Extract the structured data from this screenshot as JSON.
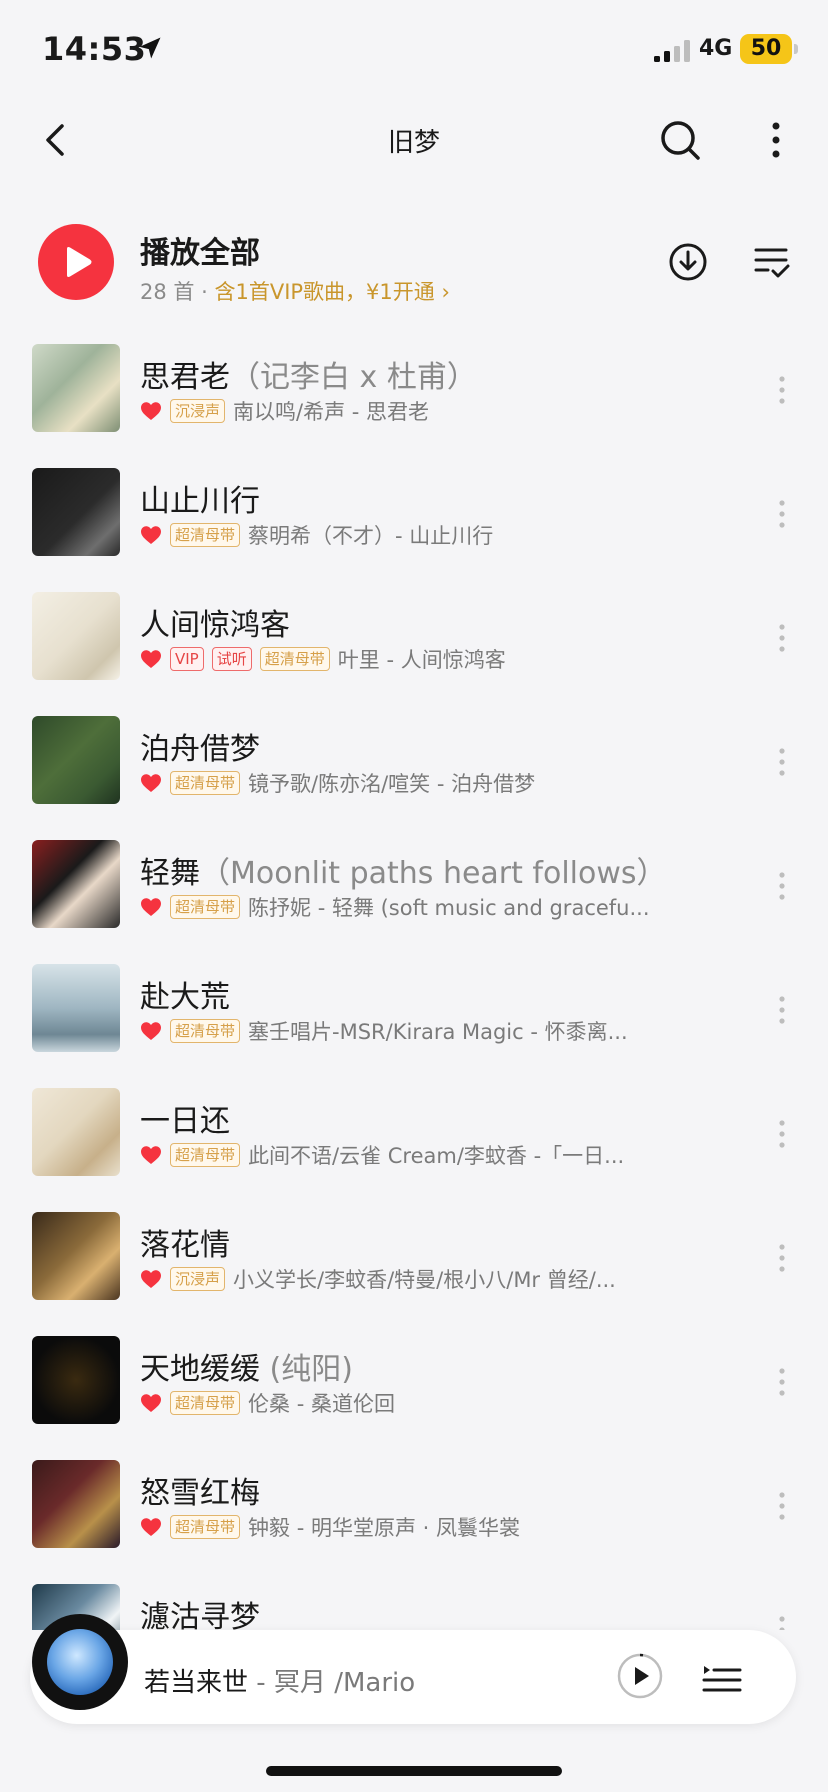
{
  "status_bar": {
    "time": "14:53",
    "network": "4G",
    "battery": "50"
  },
  "header": {
    "title": "旧梦"
  },
  "play_all": {
    "title": "播放全部",
    "count": "28 首",
    "separator": "·",
    "vip_text": "含1首VIP歌曲，¥1开通",
    "vip_chevron": "›"
  },
  "songs": [
    {
      "title": "思君老",
      "suffix": "（记李白 x 杜甫）",
      "tags": [
        "沉浸声"
      ],
      "artist": "南以鸣/希声 - 思君老",
      "cover": "cover-1"
    },
    {
      "title": "山止川行",
      "suffix": "",
      "tags": [
        "超清母带"
      ],
      "artist": "蔡明希（不才）- 山止川行",
      "cover": "cover-2"
    },
    {
      "title": "人间惊鸿客",
      "suffix": "",
      "tags": [
        "VIP",
        "试听",
        "超清母带"
      ],
      "artist": "叶里 - 人间惊鸿客",
      "cover": "cover-3"
    },
    {
      "title": "泊舟借梦",
      "suffix": "",
      "tags": [
        "超清母带"
      ],
      "artist": "镜予歌/陈亦洺/喧笑 - 泊舟借梦",
      "cover": "cover-4"
    },
    {
      "title": "轻舞",
      "suffix": "（Moonlit paths heart follows）",
      "tags": [
        "超清母带"
      ],
      "artist": "陈抒妮 - 轻舞 (soft music and gracefu...",
      "cover": "cover-5"
    },
    {
      "title": "赴大荒",
      "suffix": "",
      "tags": [
        "超清母带"
      ],
      "artist": "塞壬唱片-MSR/Kirara Magic - 怀黍离...",
      "cover": "cover-6"
    },
    {
      "title": "一日还",
      "suffix": "",
      "tags": [
        "超清母带"
      ],
      "artist": "此间不语/云雀 Cream/李蚊香 -「一日...",
      "cover": "cover-7"
    },
    {
      "title": "落花情",
      "suffix": "",
      "tags": [
        "沉浸声"
      ],
      "artist": "小义学长/李蚊香/特曼/根小八/Mr 曾经/...",
      "cover": "cover-8"
    },
    {
      "title": "天地缓缓",
      "suffix": " (纯阳)",
      "tags": [
        "超清母带"
      ],
      "artist": "伦桑 - 桑道伦回",
      "cover": "cover-9"
    },
    {
      "title": "怒雪红梅",
      "suffix": "",
      "tags": [
        "超清母带"
      ],
      "artist": "钟毅 - 明华堂原声 · 凤鬟华裳",
      "cover": "cover-10"
    },
    {
      "title": "濾沽寻梦",
      "suffix": "",
      "tags": [],
      "artist": "",
      "cover": "cover-11"
    }
  ],
  "now_playing": {
    "title": "若当来世",
    "artist": " - 冥月 /Mario"
  },
  "colors": {
    "accent_red": "#f5333f",
    "vip_gold": "#c9962c",
    "tag_gold": "#d6a04a",
    "tag_red": "#e64545"
  },
  "icons": [
    "back-icon",
    "search-icon",
    "more-vertical-icon",
    "play-icon",
    "download-icon",
    "manage-list-icon",
    "heart-icon",
    "playlist-icon"
  ]
}
